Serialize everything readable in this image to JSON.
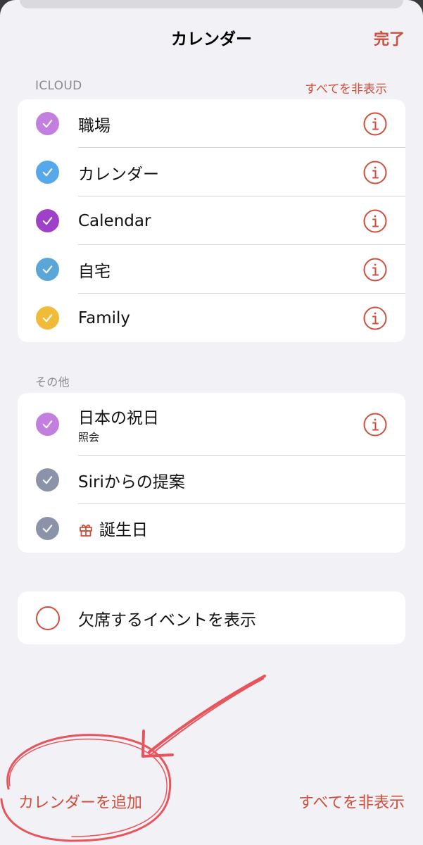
{
  "header": {
    "title": "カレンダー",
    "done_label": "完了"
  },
  "icloud": {
    "header": "ICLOUD",
    "hide_all_label": "すべてを非表示",
    "items": [
      {
        "label": "職場",
        "color": "#c37fe0"
      },
      {
        "label": "カレンダー",
        "color": "#56a8ea"
      },
      {
        "label": "Calendar",
        "color": "#a040c8"
      },
      {
        "label": "自宅",
        "color": "#5aa6d7"
      },
      {
        "label": "Family",
        "color": "#f1bb3a"
      }
    ]
  },
  "other": {
    "header": "その他",
    "items": [
      {
        "label": "日本の祝日",
        "sublabel": "照会",
        "color": "#c37fe0"
      },
      {
        "label": "Siriからの提案",
        "color": "#8a93a8"
      },
      {
        "label": "誕生日",
        "color": "#8a93a8",
        "icon": "gift-icon"
      }
    ]
  },
  "declined": {
    "label": "欠席するイベントを表示"
  },
  "footer": {
    "add_calendar_label": "カレンダーを追加",
    "hide_all_label": "すべてを非表示"
  },
  "colors": {
    "accent": "#cf4e3c",
    "background": "#f2f1f6",
    "annotation": "#e8444c"
  }
}
